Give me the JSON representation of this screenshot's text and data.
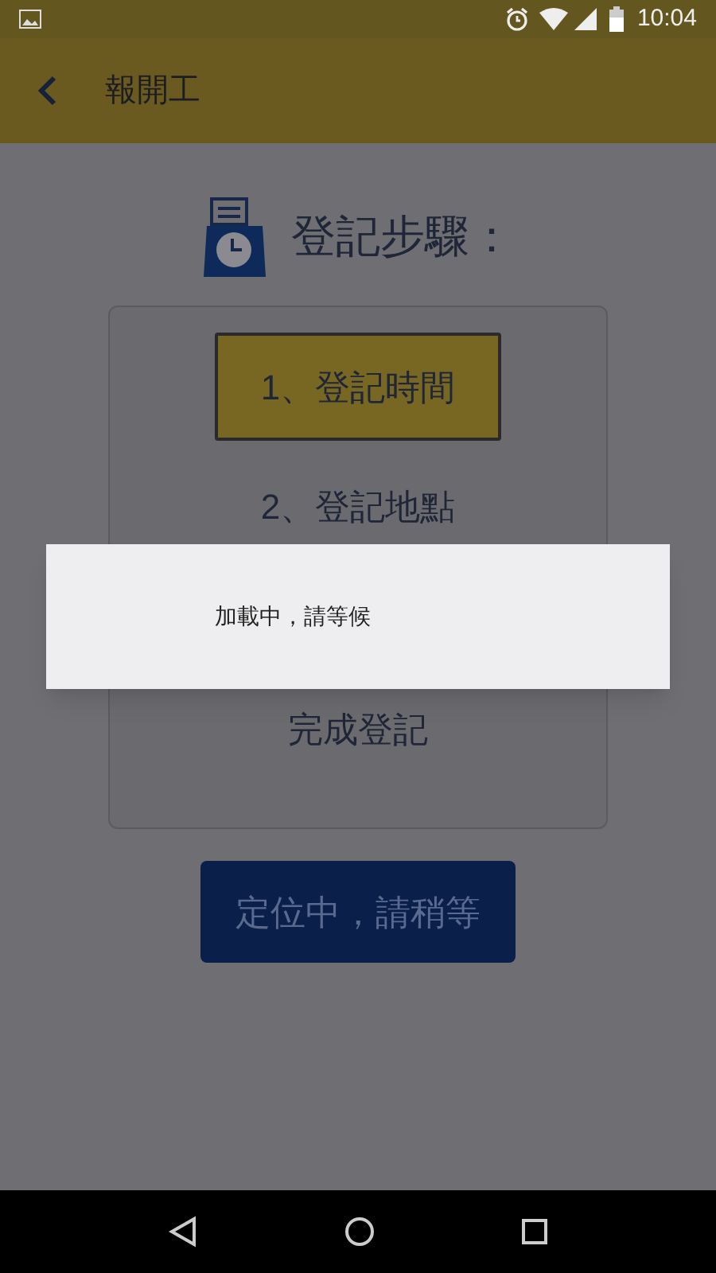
{
  "status_bar": {
    "time": "10:04"
  },
  "app_bar": {
    "title": "報開工"
  },
  "heading": "登記步驟：",
  "steps": [
    {
      "label": "1、登記時間",
      "selected": true
    },
    {
      "label": "2、登記地點",
      "selected": false
    },
    {
      "label": "完成登記",
      "selected": false
    }
  ],
  "button": {
    "label": "定位中，請稍等"
  },
  "dialog": {
    "message": "加載中，請等候"
  }
}
